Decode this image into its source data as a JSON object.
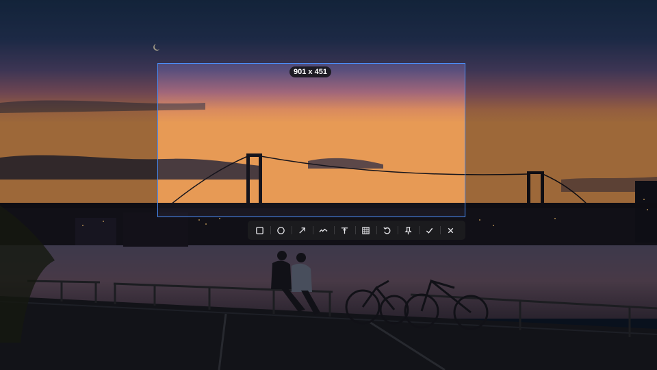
{
  "capture": {
    "size_label": "901 x 451"
  },
  "toolbar": {
    "tools": [
      {
        "name": "rectangle-tool",
        "icon": "square-icon"
      },
      {
        "name": "ellipse-tool",
        "icon": "circle-icon"
      },
      {
        "name": "arrow-tool",
        "icon": "arrow-icon"
      },
      {
        "name": "pen-tool",
        "icon": "freehand-icon"
      },
      {
        "name": "text-tool",
        "icon": "text-icon"
      },
      {
        "name": "mosaic-tool",
        "icon": "mosaic-icon"
      },
      {
        "name": "undo-tool",
        "icon": "undo-icon"
      },
      {
        "name": "pin-tool",
        "icon": "pin-icon"
      },
      {
        "name": "confirm-tool",
        "icon": "check-icon"
      },
      {
        "name": "cancel-tool",
        "icon": "close-icon"
      }
    ]
  },
  "colors": {
    "selection_border": "#4a90ff",
    "toolbar_bg": "#1c1c20",
    "icon": "#e8e8ec"
  }
}
